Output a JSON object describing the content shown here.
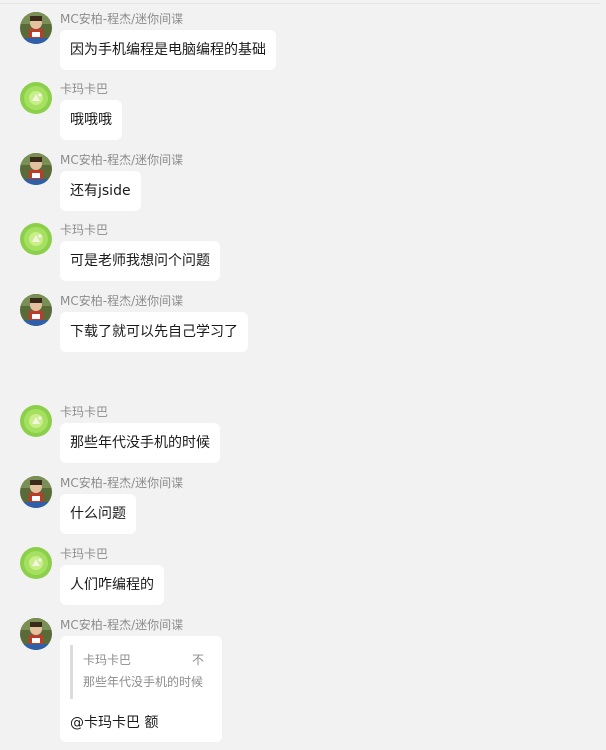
{
  "users": {
    "mc": "MC安柏-程杰/迷你间谍",
    "kama": "卡玛卡巴"
  },
  "messages": [
    {
      "sender": "MC安柏-程杰/迷你间谍",
      "text": "因为手机编程是电脑编程的基础"
    },
    {
      "sender": "卡玛卡巴",
      "text": "哦哦哦"
    },
    {
      "sender": "MC安柏-程杰/迷你间谍",
      "text": "还有jside"
    },
    {
      "sender": "卡玛卡巴",
      "text": "可是老师我想问个问题"
    },
    {
      "sender": "MC安柏-程杰/迷你间谍",
      "text": "下载了就可以先自己学习了"
    },
    {
      "sender": "卡玛卡巴",
      "text": "那些年代没手机的时候"
    },
    {
      "sender": "MC安柏-程杰/迷你间谍",
      "text": "什么问题"
    },
    {
      "sender": "卡玛卡巴",
      "text": "人们咋编程的"
    },
    {
      "sender": "MC安柏-程杰/迷你间谍",
      "quote_name": "卡玛卡巴",
      "quote_flag": "不",
      "quote_text": "那些年代没手机的时候",
      "text": "@卡玛卡巴 额"
    }
  ],
  "colors": {
    "background": "#f2f2f2",
    "bubble": "#ffffff",
    "name_text": "#8c8c8c",
    "message_text": "#1a1a1a"
  },
  "icons": {
    "mc_avatar": "avatar-mc-icon",
    "kama_avatar": "avatar-kama-icon"
  }
}
